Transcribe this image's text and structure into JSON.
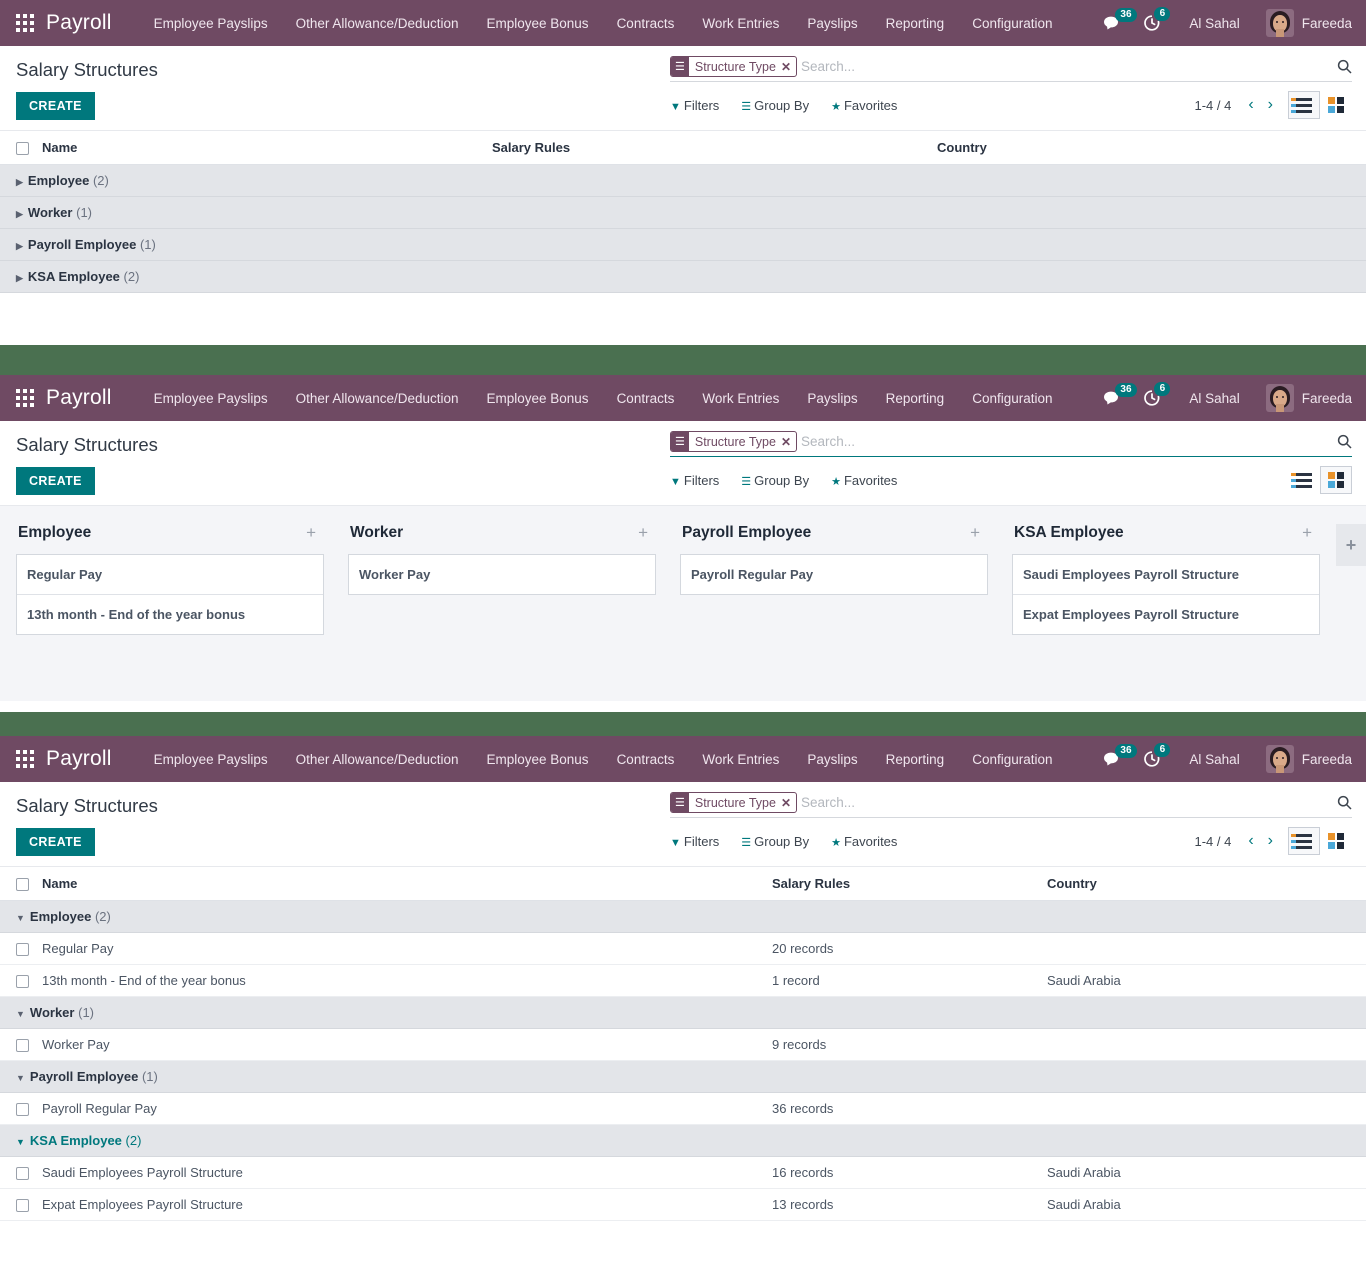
{
  "navbar": {
    "apps_icon": "apps-grid-icon",
    "brand": "Payroll",
    "menu": [
      "Employee Payslips",
      "Other Allowance/Deduction",
      "Employee Bonus",
      "Contracts",
      "Work Entries",
      "Payslips",
      "Reporting",
      "Configuration"
    ],
    "messages_icon": "chat-bubble-icon",
    "messages_count": "36",
    "activities_icon": "clock-activity-icon",
    "activities_count": "6",
    "company": "Al Sahal",
    "username": "Fareeda",
    "bg_color": "#6f4a63",
    "badge_color": "#00787d"
  },
  "band_color": "#4a7050",
  "control": {
    "title": "Salary Structures",
    "create_label": "CREATE",
    "create_color": "#00787d",
    "facet_label": "Structure Type",
    "facet_icon": "group-by-icon",
    "facet_remove_icon": "close-icon",
    "search_placeholder": "Search...",
    "search_value": "",
    "search_icon": "search-icon",
    "filters_label": "Filters",
    "filters_icon": "filter-icon",
    "groupby_label": "Group By",
    "groupby_icon": "list-lines-icon",
    "favorites_label": "Favorites",
    "favorites_icon": "star-icon",
    "pager": "1-4 / 4",
    "prev_icon": "chevron-left-icon",
    "next_icon": "chevron-right-icon",
    "list_view_icon": "list-view-icon",
    "kanban_view_icon": "kanban-view-icon"
  },
  "list_columns": {
    "name": "Name",
    "salary_rules": "Salary Rules",
    "country": "Country"
  },
  "panel1": {
    "active_view": "list",
    "groups": [
      {
        "label": "Employee",
        "count": "(2)"
      },
      {
        "label": "Worker",
        "count": "(1)"
      },
      {
        "label": "Payroll Employee",
        "count": "(1)"
      },
      {
        "label": "KSA Employee",
        "count": "(2)"
      }
    ]
  },
  "panel2": {
    "active_view": "kanban",
    "columns": [
      {
        "title": "Employee",
        "cards": [
          "Regular Pay",
          "13th month - End of the year bonus"
        ]
      },
      {
        "title": "Worker",
        "cards": [
          "Worker Pay"
        ]
      },
      {
        "title": "Payroll Employee",
        "cards": [
          "Payroll Regular Pay"
        ]
      },
      {
        "title": "KSA Employee",
        "cards": [
          "Saudi Employees Payroll Structure",
          "Expat Employees Payroll Structure"
        ]
      }
    ],
    "add_column_icon": "plus-icon"
  },
  "panel3": {
    "active_view": "list",
    "groups": [
      {
        "label": "Employee",
        "count": "(2)",
        "hovered": false,
        "rows": [
          {
            "name": "Regular Pay",
            "rules": "20 records",
            "country": ""
          },
          {
            "name": "13th month - End of the year bonus",
            "rules": "1 record",
            "country": "Saudi Arabia"
          }
        ]
      },
      {
        "label": "Worker",
        "count": "(1)",
        "hovered": false,
        "rows": [
          {
            "name": "Worker Pay",
            "rules": "9 records",
            "country": ""
          }
        ]
      },
      {
        "label": "Payroll Employee",
        "count": "(1)",
        "hovered": false,
        "rows": [
          {
            "name": "Payroll Regular Pay",
            "rules": "36 records",
            "country": ""
          }
        ]
      },
      {
        "label": "KSA Employee",
        "count": "(2)",
        "hovered": true,
        "rows": [
          {
            "name": "Saudi Employees Payroll Structure",
            "rules": "16 records",
            "country": "Saudi Arabia"
          },
          {
            "name": "Expat Employees Payroll Structure",
            "rules": "13 records",
            "country": "Saudi Arabia"
          }
        ]
      }
    ]
  }
}
